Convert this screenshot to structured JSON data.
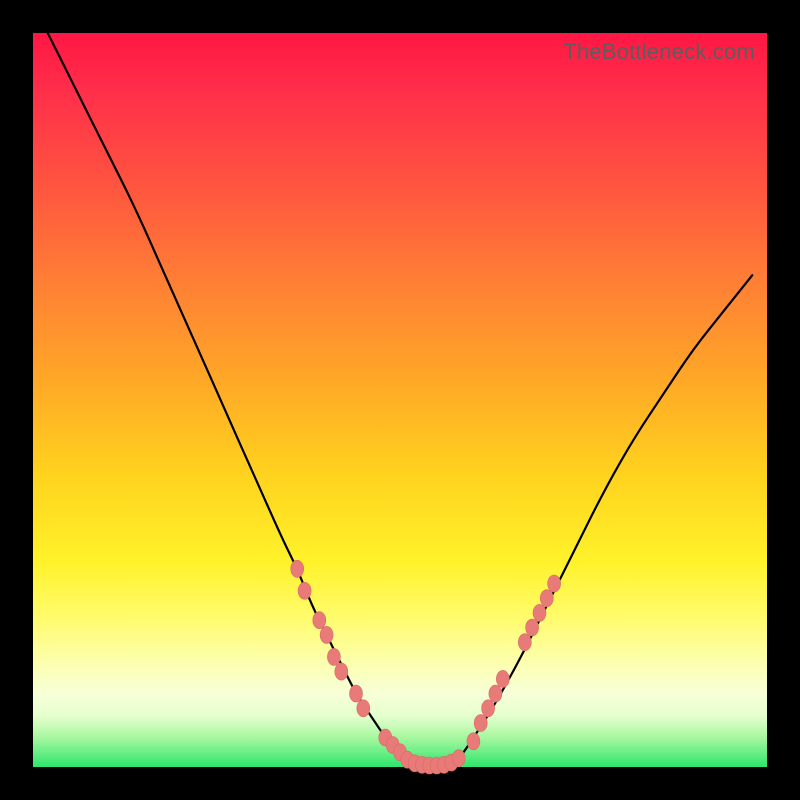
{
  "watermark": "TheBottleneck.com",
  "colors": {
    "curve_stroke": "#000000",
    "marker_fill": "#e87a77",
    "marker_stroke": "#d66c68"
  },
  "chart_data": {
    "type": "line",
    "title": "",
    "xlabel": "",
    "ylabel": "",
    "xlim": [
      0,
      100
    ],
    "ylim": [
      0,
      100
    ],
    "series": [
      {
        "name": "bottleneck-curve",
        "x": [
          2,
          6,
          10,
          14,
          18,
          22,
          26,
          30,
          34,
          36,
          38,
          40,
          42,
          44,
          46,
          48,
          50,
          52,
          54,
          56,
          58,
          60,
          62,
          66,
          70,
          74,
          78,
          82,
          86,
          90,
          94,
          98
        ],
        "y": [
          100,
          92,
          84,
          76,
          67,
          58,
          49,
          40,
          31,
          27,
          22,
          18,
          14,
          10,
          7,
          4,
          2,
          1,
          0,
          0,
          1,
          4,
          7,
          14,
          22,
          30,
          38,
          45,
          51,
          57,
          62,
          67
        ]
      }
    ],
    "markers": {
      "name": "highlighted-points",
      "points": [
        {
          "x": 36,
          "y": 27
        },
        {
          "x": 37,
          "y": 24
        },
        {
          "x": 39,
          "y": 20
        },
        {
          "x": 40,
          "y": 18
        },
        {
          "x": 41,
          "y": 15
        },
        {
          "x": 42,
          "y": 13
        },
        {
          "x": 44,
          "y": 10
        },
        {
          "x": 45,
          "y": 8
        },
        {
          "x": 48,
          "y": 4
        },
        {
          "x": 49,
          "y": 3
        },
        {
          "x": 50,
          "y": 2
        },
        {
          "x": 51,
          "y": 1
        },
        {
          "x": 52,
          "y": 0.5
        },
        {
          "x": 53,
          "y": 0.3
        },
        {
          "x": 54,
          "y": 0.2
        },
        {
          "x": 55,
          "y": 0.2
        },
        {
          "x": 56,
          "y": 0.3
        },
        {
          "x": 57,
          "y": 0.6
        },
        {
          "x": 58,
          "y": 1.2
        },
        {
          "x": 60,
          "y": 3.5
        },
        {
          "x": 61,
          "y": 6
        },
        {
          "x": 62,
          "y": 8
        },
        {
          "x": 63,
          "y": 10
        },
        {
          "x": 64,
          "y": 12
        },
        {
          "x": 67,
          "y": 17
        },
        {
          "x": 68,
          "y": 19
        },
        {
          "x": 69,
          "y": 21
        },
        {
          "x": 70,
          "y": 23
        },
        {
          "x": 71,
          "y": 25
        }
      ]
    }
  }
}
